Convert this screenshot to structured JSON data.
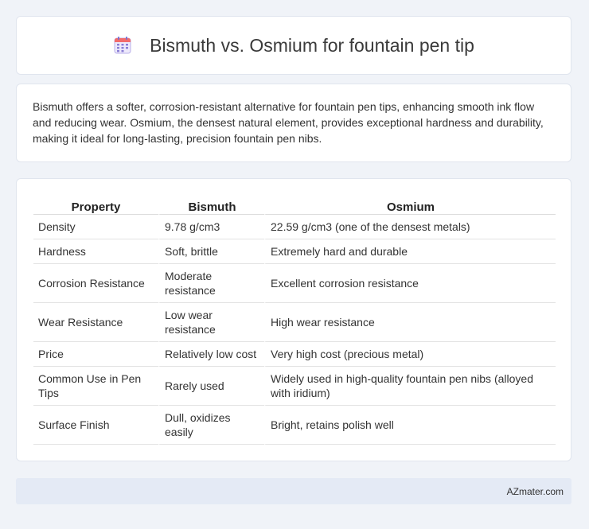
{
  "header": {
    "title": "Bismuth vs. Osmium for fountain pen tip",
    "icon": "calendar-icon",
    "icon_color": "#8b7fd6"
  },
  "description": "Bismuth offers a softer, corrosion-resistant alternative for fountain pen tips, enhancing smooth ink flow and reducing wear. Osmium, the densest natural element, provides exceptional hardness and durability, making it ideal for long-lasting, precision fountain pen nibs.",
  "table": {
    "headers": [
      "Property",
      "Bismuth",
      "Osmium"
    ],
    "rows": [
      [
        "Density",
        "9.78 g/cm3",
        "22.59 g/cm3 (one of the densest metals)"
      ],
      [
        "Hardness",
        "Soft, brittle",
        "Extremely hard and durable"
      ],
      [
        "Corrosion Resistance",
        "Moderate resistance",
        "Excellent corrosion resistance"
      ],
      [
        "Wear Resistance",
        "Low wear resistance",
        "High wear resistance"
      ],
      [
        "Price",
        "Relatively low cost",
        "Very high cost (precious metal)"
      ],
      [
        "Common Use in Pen Tips",
        "Rarely used",
        "Widely used in high-quality fountain pen nibs (alloyed with iridium)"
      ],
      [
        "Surface Finish",
        "Dull, oxidizes easily",
        "Bright, retains polish well"
      ]
    ]
  },
  "footer": {
    "text": "AZmater.com"
  },
  "colors": {
    "background": "#f0f3f8",
    "card": "#ffffff",
    "footer_bg": "#e4eaf5"
  }
}
